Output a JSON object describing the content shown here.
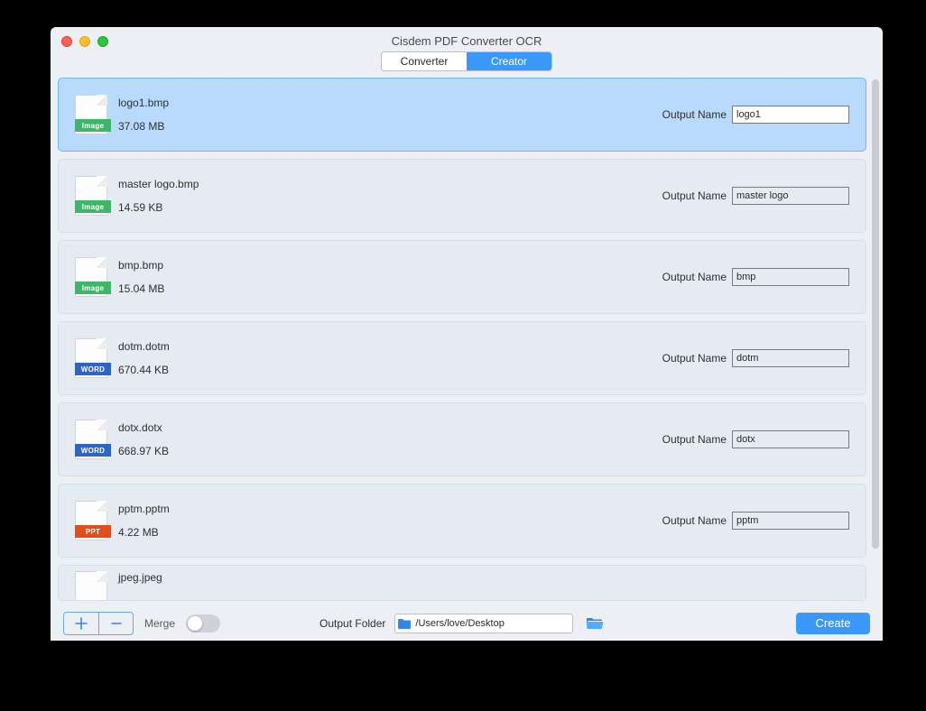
{
  "title": "Cisdem PDF Converter OCR",
  "tabs": {
    "left": "Converter",
    "right": "Creator",
    "active": "right"
  },
  "output_name_label": "Output Name",
  "files": [
    {
      "name": "logo1.bmp",
      "size": "37.08 MB",
      "type": "Image",
      "out": "logo1",
      "selected": true
    },
    {
      "name": "master logo.bmp",
      "size": "14.59 KB",
      "type": "Image",
      "out": "master logo",
      "selected": false
    },
    {
      "name": "bmp.bmp",
      "size": "15.04 MB",
      "type": "Image",
      "out": "bmp",
      "selected": false
    },
    {
      "name": "dotm.dotm",
      "size": "670.44 KB",
      "type": "WORD",
      "out": "dotm",
      "selected": false
    },
    {
      "name": "dotx.dotx",
      "size": "668.97 KB",
      "type": "WORD",
      "out": "dotx",
      "selected": false
    },
    {
      "name": "pptm.pptm",
      "size": "4.22 MB",
      "type": "PPT",
      "out": "pptm",
      "selected": false
    },
    {
      "name": "jpeg.jpeg",
      "size": "",
      "type": "",
      "out": "",
      "selected": false,
      "cut": true
    }
  ],
  "footer": {
    "merge_label": "Merge",
    "output_folder_label": "Output Folder",
    "output_folder_path": "/Users/love/Desktop",
    "create_label": "Create"
  },
  "icon_tag_text": {
    "Image": "Image",
    "WORD": "WORD",
    "PPT": "PPT"
  }
}
